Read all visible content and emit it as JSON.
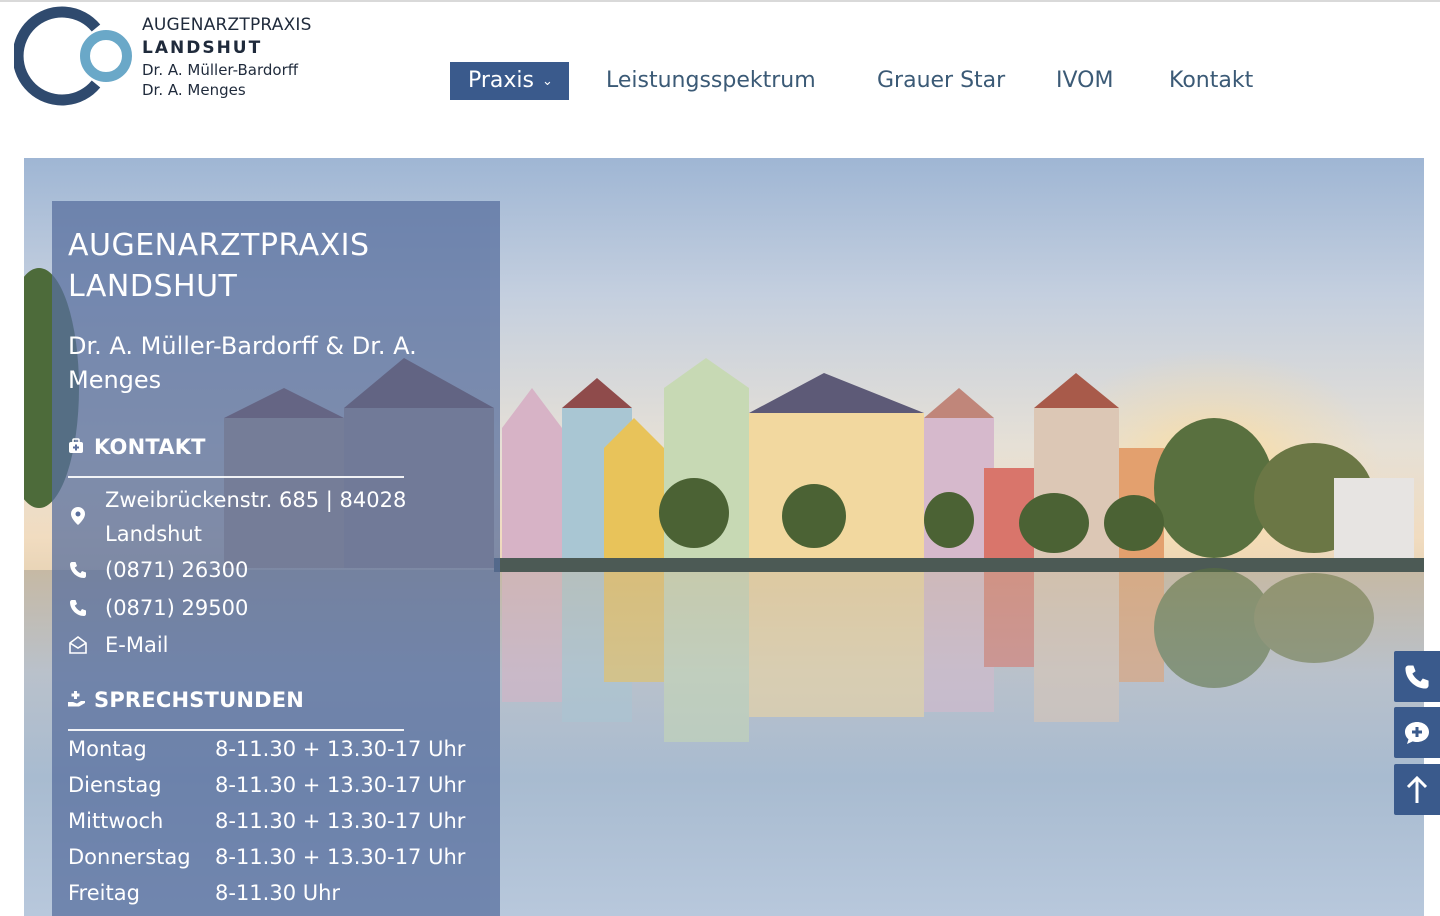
{
  "colors": {
    "brand_blue": "#3a5a8c",
    "nav_text": "#3b5a76",
    "logo_dark": "#2f4a6e",
    "logo_light": "#6aa8c8",
    "overlay": "rgba(88,110,158,0.74)"
  },
  "logo": {
    "line1": "AUGENARZTPRAXIS",
    "line2": "LANDSHUT",
    "doctor1": "Dr. A. Müller-Bardorff",
    "doctor2": "Dr. A. Menges"
  },
  "nav": {
    "items": [
      {
        "label": "Praxis",
        "active": true,
        "has_dropdown": true
      },
      {
        "label": "Leistungsspektrum"
      },
      {
        "label": "Grauer Star"
      },
      {
        "label": "IVOM"
      },
      {
        "label": "Kontakt"
      }
    ]
  },
  "info": {
    "title": "AUGENARZTPRAXIS LANDSHUT",
    "doctors": "Dr. A. Müller-Bardorff & Dr. A. Menges",
    "contact_heading": "KONTAKT",
    "address": "Zweibrückenstr. 685 | 84028 Landshut",
    "phone1": "(0871) 26300",
    "phone2": "(0871) 29500",
    "email_label": "E-Mail",
    "hours_heading": "SPRECHSTUNDEN",
    "hours": [
      {
        "day": "Montag",
        "time": "8-11.30 + 13.30-17 Uhr"
      },
      {
        "day": "Dienstag",
        "time": "8-11.30 + 13.30-17 Uhr"
      },
      {
        "day": "Mittwoch",
        "time": "8-11.30 + 13.30-17 Uhr"
      },
      {
        "day": "Donnerstag",
        "time": "8-11.30 + 13.30-17 Uhr"
      },
      {
        "day": "Freitag",
        "time": "8-11.30 Uhr"
      }
    ]
  },
  "icons": {
    "address": "map-pin-icon",
    "phone": "phone-icon",
    "email": "envelope-open-icon",
    "contact_heading": "medical-case-icon",
    "hours_heading": "hand-holding-medical-icon",
    "float_phone": "phone-icon",
    "float_chat": "comment-medical-icon",
    "float_top": "arrow-up-icon"
  }
}
